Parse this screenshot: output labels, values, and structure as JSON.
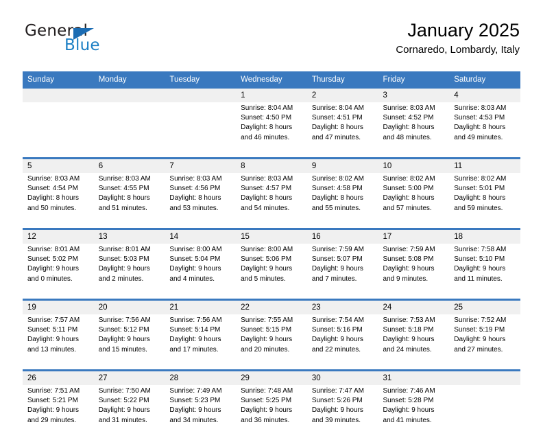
{
  "brand": {
    "name_top": "General",
    "name_bottom": "Blue",
    "triangle_icon": "triangle-icon",
    "color_dark": "#231f20",
    "color_blue": "#1c7fc4"
  },
  "header": {
    "title": "January 2025",
    "subtitle": "Cornaredo, Lombardy, Italy"
  },
  "theme": {
    "header_blue": "#3a79bf",
    "daynum_band": "#f0f0f0",
    "text": "#000000"
  },
  "calendar": {
    "weekday_headers": [
      "Sunday",
      "Monday",
      "Tuesday",
      "Wednesday",
      "Thursday",
      "Friday",
      "Saturday"
    ],
    "weeks": [
      {
        "days": [
          {
            "num": "",
            "sunrise": "",
            "sunset": "",
            "daylight_1": "",
            "daylight_2": ""
          },
          {
            "num": "",
            "sunrise": "",
            "sunset": "",
            "daylight_1": "",
            "daylight_2": ""
          },
          {
            "num": "",
            "sunrise": "",
            "sunset": "",
            "daylight_1": "",
            "daylight_2": ""
          },
          {
            "num": "1",
            "sunrise": "Sunrise: 8:04 AM",
            "sunset": "Sunset: 4:50 PM",
            "daylight_1": "Daylight: 8 hours",
            "daylight_2": "and 46 minutes."
          },
          {
            "num": "2",
            "sunrise": "Sunrise: 8:04 AM",
            "sunset": "Sunset: 4:51 PM",
            "daylight_1": "Daylight: 8 hours",
            "daylight_2": "and 47 minutes."
          },
          {
            "num": "3",
            "sunrise": "Sunrise: 8:03 AM",
            "sunset": "Sunset: 4:52 PM",
            "daylight_1": "Daylight: 8 hours",
            "daylight_2": "and 48 minutes."
          },
          {
            "num": "4",
            "sunrise": "Sunrise: 8:03 AM",
            "sunset": "Sunset: 4:53 PM",
            "daylight_1": "Daylight: 8 hours",
            "daylight_2": "and 49 minutes."
          }
        ]
      },
      {
        "days": [
          {
            "num": "5",
            "sunrise": "Sunrise: 8:03 AM",
            "sunset": "Sunset: 4:54 PM",
            "daylight_1": "Daylight: 8 hours",
            "daylight_2": "and 50 minutes."
          },
          {
            "num": "6",
            "sunrise": "Sunrise: 8:03 AM",
            "sunset": "Sunset: 4:55 PM",
            "daylight_1": "Daylight: 8 hours",
            "daylight_2": "and 51 minutes."
          },
          {
            "num": "7",
            "sunrise": "Sunrise: 8:03 AM",
            "sunset": "Sunset: 4:56 PM",
            "daylight_1": "Daylight: 8 hours",
            "daylight_2": "and 53 minutes."
          },
          {
            "num": "8",
            "sunrise": "Sunrise: 8:03 AM",
            "sunset": "Sunset: 4:57 PM",
            "daylight_1": "Daylight: 8 hours",
            "daylight_2": "and 54 minutes."
          },
          {
            "num": "9",
            "sunrise": "Sunrise: 8:02 AM",
            "sunset": "Sunset: 4:58 PM",
            "daylight_1": "Daylight: 8 hours",
            "daylight_2": "and 55 minutes."
          },
          {
            "num": "10",
            "sunrise": "Sunrise: 8:02 AM",
            "sunset": "Sunset: 5:00 PM",
            "daylight_1": "Daylight: 8 hours",
            "daylight_2": "and 57 minutes."
          },
          {
            "num": "11",
            "sunrise": "Sunrise: 8:02 AM",
            "sunset": "Sunset: 5:01 PM",
            "daylight_1": "Daylight: 8 hours",
            "daylight_2": "and 59 minutes."
          }
        ]
      },
      {
        "days": [
          {
            "num": "12",
            "sunrise": "Sunrise: 8:01 AM",
            "sunset": "Sunset: 5:02 PM",
            "daylight_1": "Daylight: 9 hours",
            "daylight_2": "and 0 minutes."
          },
          {
            "num": "13",
            "sunrise": "Sunrise: 8:01 AM",
            "sunset": "Sunset: 5:03 PM",
            "daylight_1": "Daylight: 9 hours",
            "daylight_2": "and 2 minutes."
          },
          {
            "num": "14",
            "sunrise": "Sunrise: 8:00 AM",
            "sunset": "Sunset: 5:04 PM",
            "daylight_1": "Daylight: 9 hours",
            "daylight_2": "and 4 minutes."
          },
          {
            "num": "15",
            "sunrise": "Sunrise: 8:00 AM",
            "sunset": "Sunset: 5:06 PM",
            "daylight_1": "Daylight: 9 hours",
            "daylight_2": "and 5 minutes."
          },
          {
            "num": "16",
            "sunrise": "Sunrise: 7:59 AM",
            "sunset": "Sunset: 5:07 PM",
            "daylight_1": "Daylight: 9 hours",
            "daylight_2": "and 7 minutes."
          },
          {
            "num": "17",
            "sunrise": "Sunrise: 7:59 AM",
            "sunset": "Sunset: 5:08 PM",
            "daylight_1": "Daylight: 9 hours",
            "daylight_2": "and 9 minutes."
          },
          {
            "num": "18",
            "sunrise": "Sunrise: 7:58 AM",
            "sunset": "Sunset: 5:10 PM",
            "daylight_1": "Daylight: 9 hours",
            "daylight_2": "and 11 minutes."
          }
        ]
      },
      {
        "days": [
          {
            "num": "19",
            "sunrise": "Sunrise: 7:57 AM",
            "sunset": "Sunset: 5:11 PM",
            "daylight_1": "Daylight: 9 hours",
            "daylight_2": "and 13 minutes."
          },
          {
            "num": "20",
            "sunrise": "Sunrise: 7:56 AM",
            "sunset": "Sunset: 5:12 PM",
            "daylight_1": "Daylight: 9 hours",
            "daylight_2": "and 15 minutes."
          },
          {
            "num": "21",
            "sunrise": "Sunrise: 7:56 AM",
            "sunset": "Sunset: 5:14 PM",
            "daylight_1": "Daylight: 9 hours",
            "daylight_2": "and 17 minutes."
          },
          {
            "num": "22",
            "sunrise": "Sunrise: 7:55 AM",
            "sunset": "Sunset: 5:15 PM",
            "daylight_1": "Daylight: 9 hours",
            "daylight_2": "and 20 minutes."
          },
          {
            "num": "23",
            "sunrise": "Sunrise: 7:54 AM",
            "sunset": "Sunset: 5:16 PM",
            "daylight_1": "Daylight: 9 hours",
            "daylight_2": "and 22 minutes."
          },
          {
            "num": "24",
            "sunrise": "Sunrise: 7:53 AM",
            "sunset": "Sunset: 5:18 PM",
            "daylight_1": "Daylight: 9 hours",
            "daylight_2": "and 24 minutes."
          },
          {
            "num": "25",
            "sunrise": "Sunrise: 7:52 AM",
            "sunset": "Sunset: 5:19 PM",
            "daylight_1": "Daylight: 9 hours",
            "daylight_2": "and 27 minutes."
          }
        ]
      },
      {
        "days": [
          {
            "num": "26",
            "sunrise": "Sunrise: 7:51 AM",
            "sunset": "Sunset: 5:21 PM",
            "daylight_1": "Daylight: 9 hours",
            "daylight_2": "and 29 minutes."
          },
          {
            "num": "27",
            "sunrise": "Sunrise: 7:50 AM",
            "sunset": "Sunset: 5:22 PM",
            "daylight_1": "Daylight: 9 hours",
            "daylight_2": "and 31 minutes."
          },
          {
            "num": "28",
            "sunrise": "Sunrise: 7:49 AM",
            "sunset": "Sunset: 5:23 PM",
            "daylight_1": "Daylight: 9 hours",
            "daylight_2": "and 34 minutes."
          },
          {
            "num": "29",
            "sunrise": "Sunrise: 7:48 AM",
            "sunset": "Sunset: 5:25 PM",
            "daylight_1": "Daylight: 9 hours",
            "daylight_2": "and 36 minutes."
          },
          {
            "num": "30",
            "sunrise": "Sunrise: 7:47 AM",
            "sunset": "Sunset: 5:26 PM",
            "daylight_1": "Daylight: 9 hours",
            "daylight_2": "and 39 minutes."
          },
          {
            "num": "31",
            "sunrise": "Sunrise: 7:46 AM",
            "sunset": "Sunset: 5:28 PM",
            "daylight_1": "Daylight: 9 hours",
            "daylight_2": "and 41 minutes."
          },
          {
            "num": "",
            "sunrise": "",
            "sunset": "",
            "daylight_1": "",
            "daylight_2": ""
          }
        ]
      }
    ]
  }
}
